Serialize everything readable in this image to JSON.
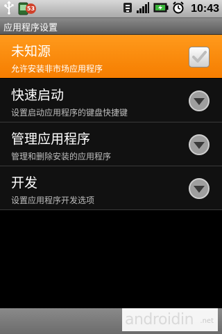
{
  "status_bar": {
    "notification_badge": "53",
    "time": "10:43",
    "icons": [
      "usb-icon",
      "notification-app-icon",
      "wifi-icon",
      "signal-icon",
      "battery-icon",
      "alarm-icon"
    ]
  },
  "title_bar": {
    "title": "应用程序设置"
  },
  "settings": [
    {
      "title": "未知源",
      "summary": "允许安装非市场应用程序",
      "control": "checkbox",
      "checked": true,
      "highlighted": true
    },
    {
      "title": "快速启动",
      "summary": "设置启动应用程序的键盘快捷键",
      "control": "arrow-button"
    },
    {
      "title": "管理应用程序",
      "summary": "管理和删除安装的应用程序",
      "control": "arrow-button"
    },
    {
      "title": "开发",
      "summary": "设置应用程序开发选项",
      "control": "arrow-button"
    }
  ],
  "watermark": {
    "brand": "androidin",
    "tld": ".net"
  },
  "colors": {
    "highlight": "#f58a0e",
    "background": "#111111",
    "status_bar": "#bcbcbc"
  }
}
